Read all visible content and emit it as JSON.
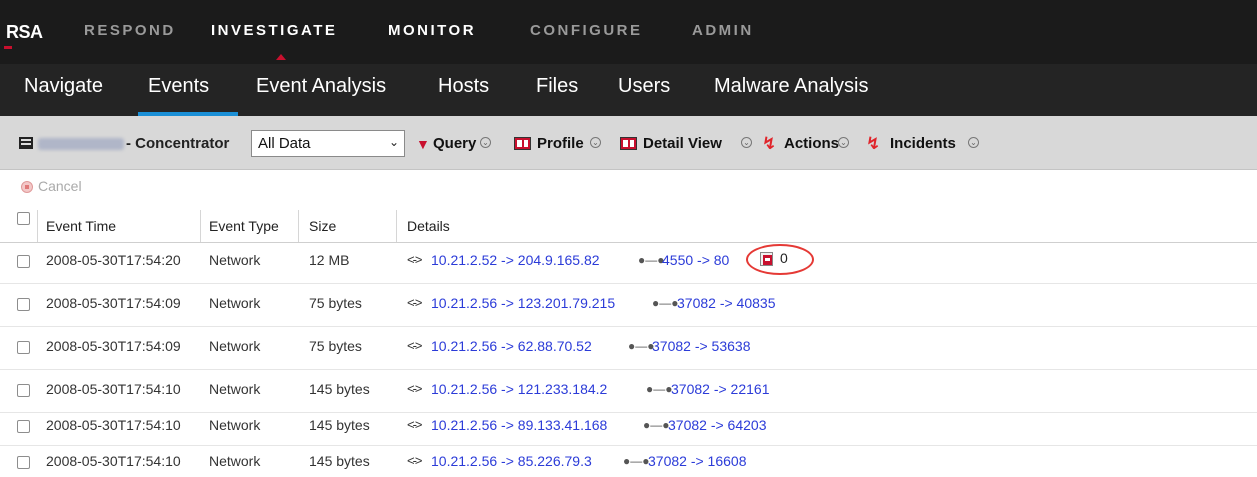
{
  "brand": {
    "logo_text": "RSA"
  },
  "topnav": {
    "items": [
      {
        "label": "RESPOND",
        "active": false
      },
      {
        "label": "INVESTIGATE",
        "active": true
      },
      {
        "label": "MONITOR",
        "active": false
      },
      {
        "label": "CONFIGURE",
        "active": false
      },
      {
        "label": "ADMIN",
        "active": false
      }
    ]
  },
  "subnav": {
    "items": [
      {
        "label": "Navigate"
      },
      {
        "label": "Events",
        "active": true
      },
      {
        "label": "Event Analysis"
      },
      {
        "label": "Hosts"
      },
      {
        "label": "Files"
      },
      {
        "label": "Users"
      },
      {
        "label": "Malware Analysis"
      }
    ]
  },
  "toolbar": {
    "service_suffix": "- Concentrator",
    "profile_select_value": "All Data",
    "query_label": "Query",
    "profile_label": "Profile",
    "detail_view_label": "Detail View",
    "actions_label": "Actions",
    "incidents_label": "Incidents"
  },
  "cancel_label": "Cancel",
  "table": {
    "columns": [
      "Event Time",
      "Event Type",
      "Size",
      "Details"
    ],
    "rows": [
      {
        "time": "2008-05-30T17:54:20",
        "type": "Network",
        "size": "12 MB",
        "ip_flow": "10.21.2.52 -> 204.9.165.82",
        "port_flow": "4550 -> 80",
        "attachment_count": "0"
      },
      {
        "time": "2008-05-30T17:54:09",
        "type": "Network",
        "size": "75 bytes",
        "ip_flow": "10.21.2.56 -> 123.201.79.215",
        "port_flow": "37082 -> 40835"
      },
      {
        "time": "2008-05-30T17:54:09",
        "type": "Network",
        "size": "75 bytes",
        "ip_flow": "10.21.2.56 -> 62.88.70.52",
        "port_flow": "37082 -> 53638"
      },
      {
        "time": "2008-05-30T17:54:10",
        "type": "Network",
        "size": "145 bytes",
        "ip_flow": "10.21.2.56 -> 121.233.184.2",
        "port_flow": "37082 -> 22161"
      },
      {
        "time": "2008-05-30T17:54:10",
        "type": "Network",
        "size": "145 bytes",
        "ip_flow": "10.21.2.56 -> 89.133.41.168",
        "port_flow": "37082 -> 64203"
      },
      {
        "time": "2008-05-30T17:54:10",
        "type": "Network",
        "size": "145 bytes",
        "ip_flow": "10.21.2.56 -> 85.226.79.3",
        "port_flow": "37082 -> 16608"
      }
    ]
  },
  "icons": {
    "service": "service-icon",
    "query": "funnel-icon",
    "profile": "profile-icon",
    "detail_view": "detail-view-icon",
    "actions": "lightning-icon",
    "incidents": "lightning-icon",
    "ip_direction": "bidirectional-arrow-icon",
    "port": "port-connector-icon",
    "attachment": "document-icon"
  },
  "colors": {
    "accent": "#c8102e",
    "active_tab_underline": "#1a8fd6",
    "link": "#2b3bd8",
    "highlight_ring": "#e53935"
  }
}
